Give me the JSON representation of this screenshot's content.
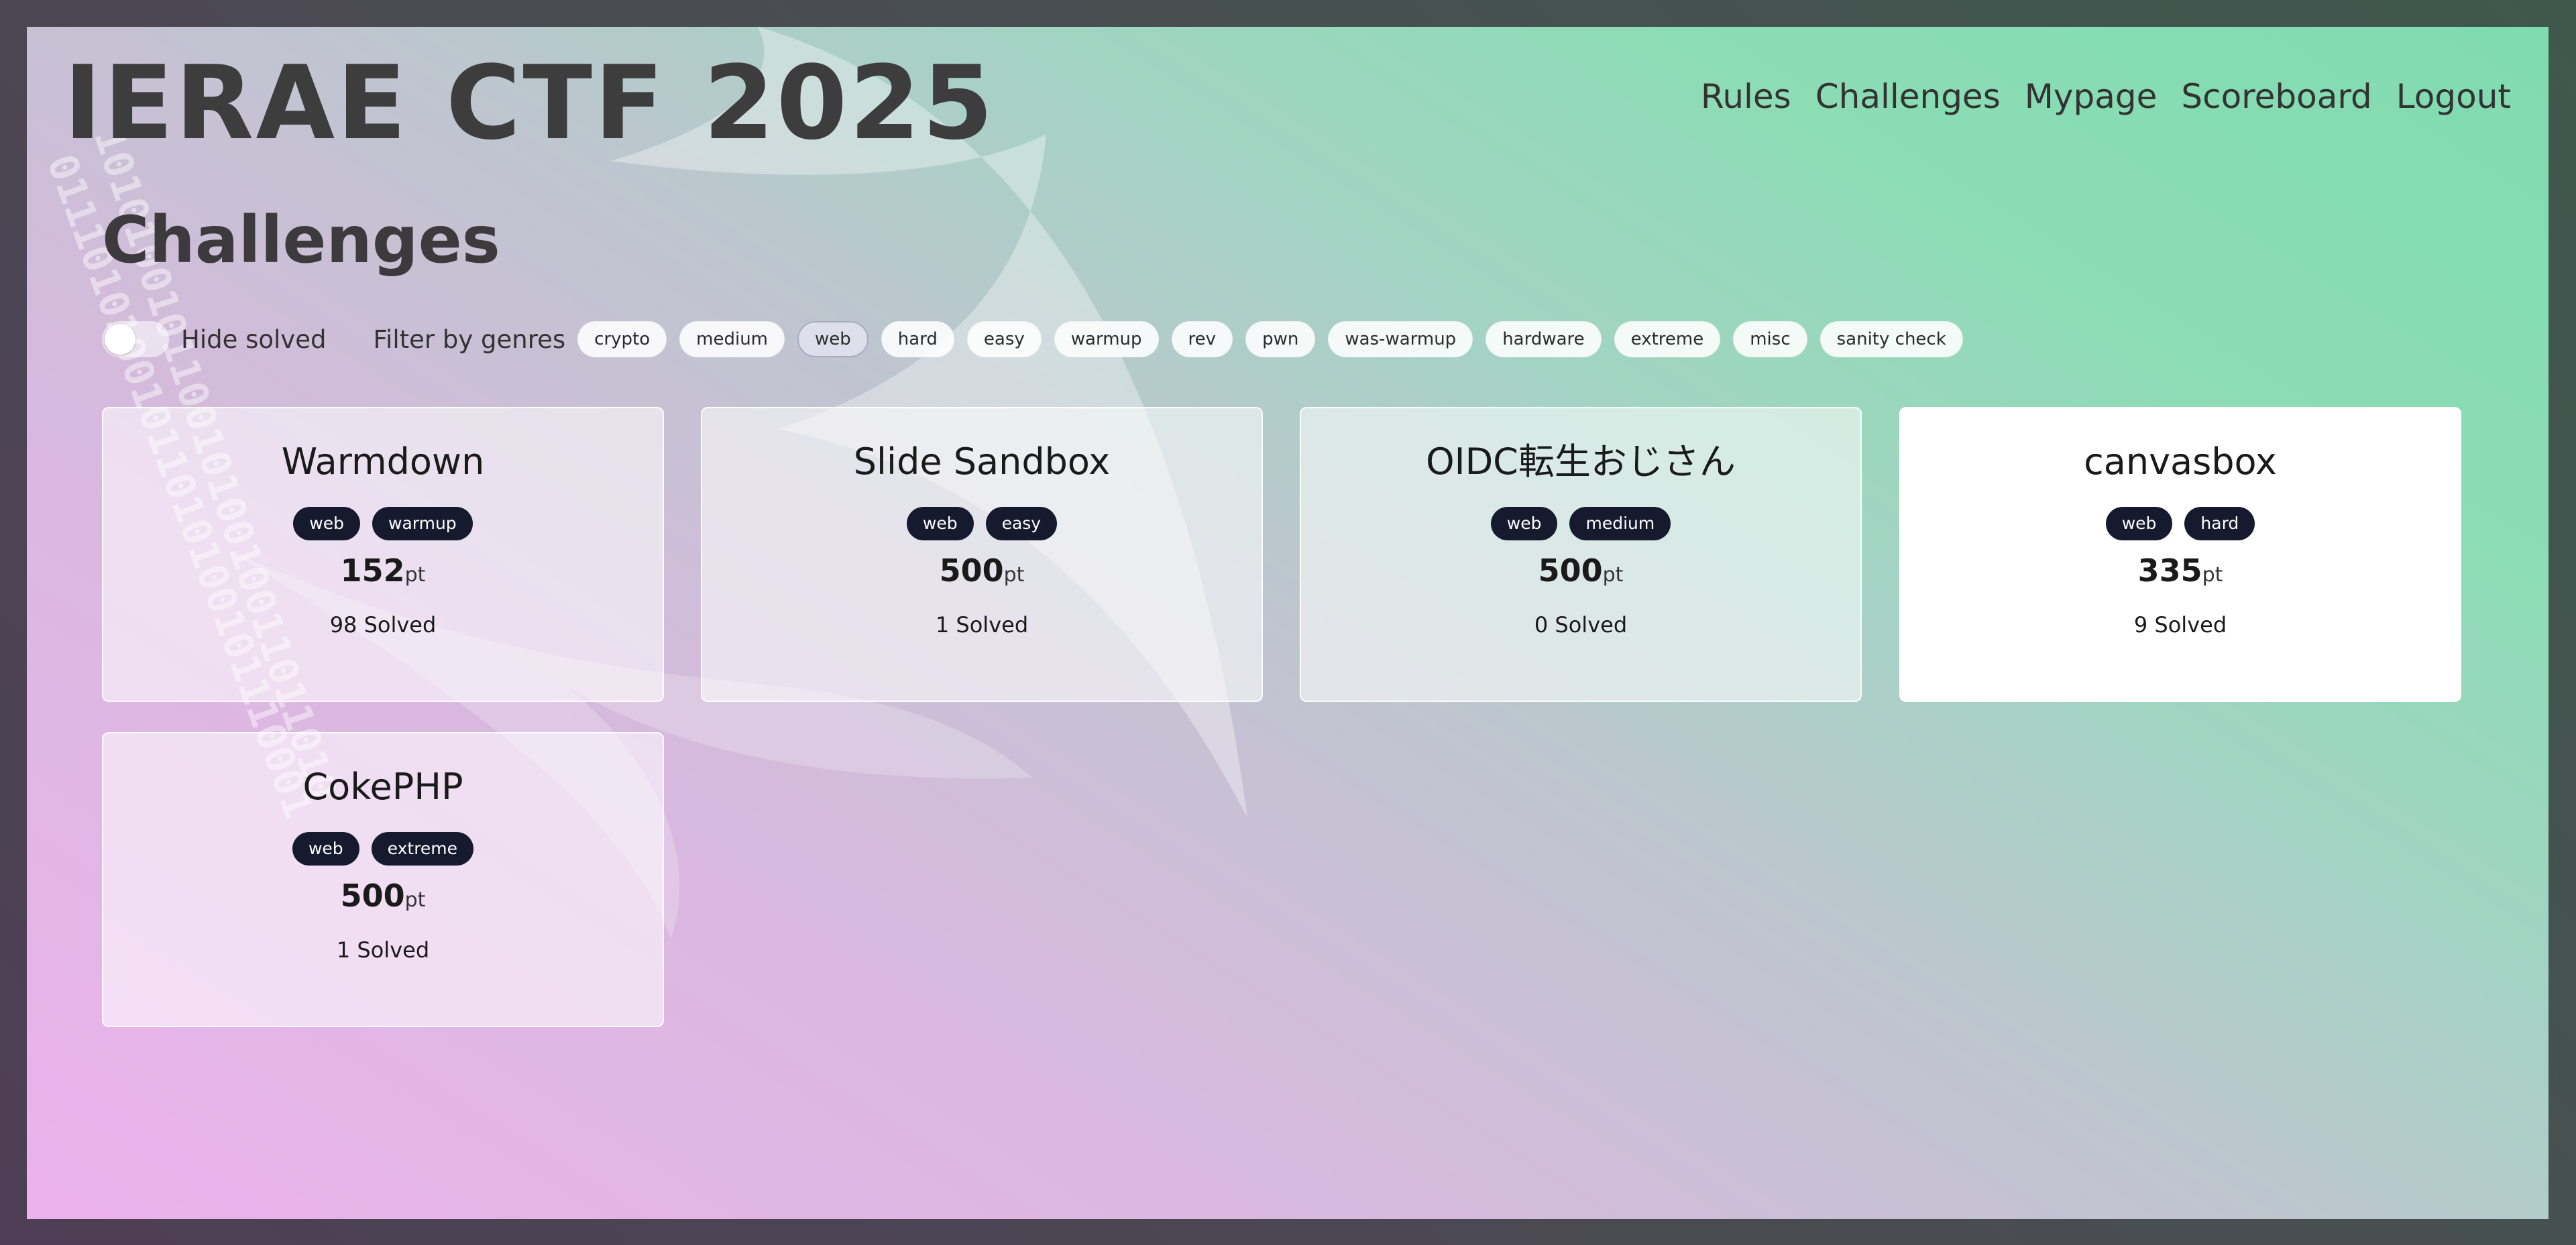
{
  "site": {
    "title": "IERAE CTF 2025"
  },
  "nav": [
    {
      "label": "Rules"
    },
    {
      "label": "Challenges"
    },
    {
      "label": "Mypage"
    },
    {
      "label": "Scoreboard"
    },
    {
      "label": "Logout"
    }
  ],
  "page": {
    "title": "Challenges"
  },
  "filters": {
    "hide_solved_label": "Hide solved",
    "hide_solved_enabled": false,
    "filter_label": "Filter by genres",
    "genres": [
      "crypto",
      "medium",
      "web",
      "hard",
      "easy",
      "warmup",
      "rev",
      "pwn",
      "was-warmup",
      "hardware",
      "extreme",
      "misc",
      "sanity check"
    ],
    "active_genre": "web"
  },
  "challenges": [
    {
      "name": "Warmdown",
      "tags": [
        "web",
        "warmup"
      ],
      "points": "152",
      "unit": "pt",
      "solved": "98 Solved"
    },
    {
      "name": "Slide Sandbox",
      "tags": [
        "web",
        "easy"
      ],
      "points": "500",
      "unit": "pt",
      "solved": "1 Solved"
    },
    {
      "name": "OIDC転生おじさん",
      "tags": [
        "web",
        "medium"
      ],
      "points": "500",
      "unit": "pt",
      "solved": "0 Solved"
    },
    {
      "name": "canvasbox",
      "tags": [
        "web",
        "hard"
      ],
      "points": "335",
      "unit": "pt",
      "solved": "9 Solved"
    },
    {
      "name": "CokePHP",
      "tags": [
        "web",
        "extreme"
      ],
      "points": "500",
      "unit": "pt",
      "solved": "1 Solved"
    }
  ],
  "colors": {
    "tag_bg": "#151a2e",
    "gradient_pink": "#ecb2ec",
    "gradient_green": "#80dbb0"
  }
}
